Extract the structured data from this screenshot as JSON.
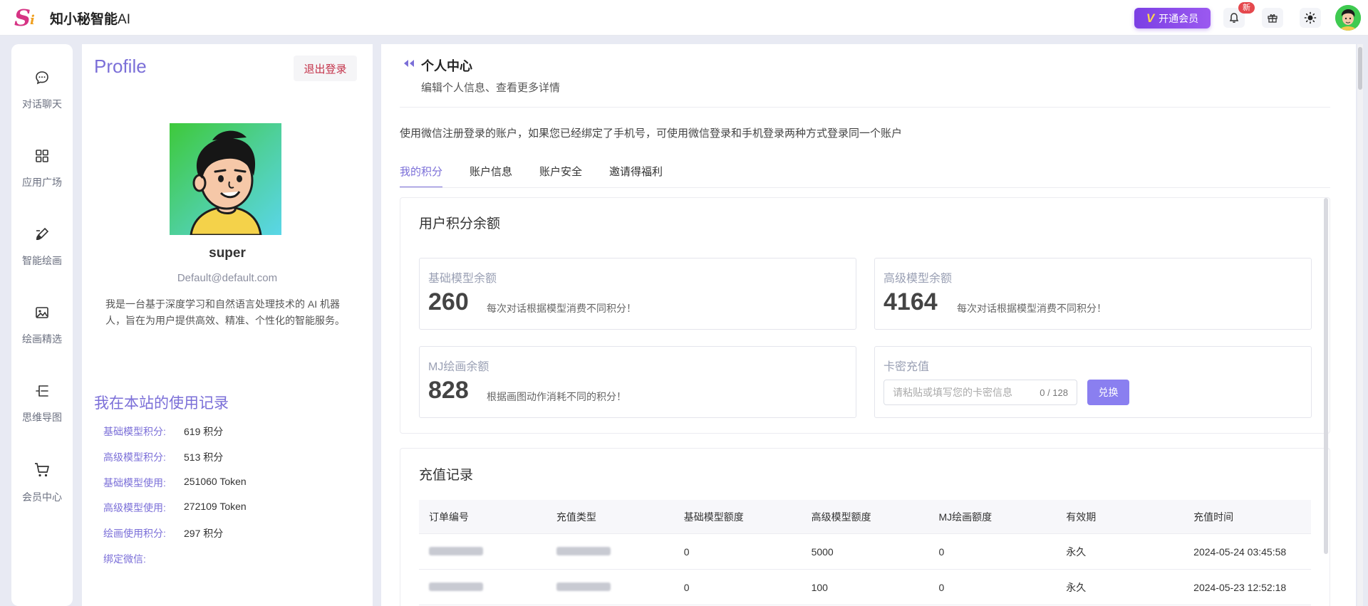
{
  "app": {
    "logo_text": "S",
    "logo_sub": "i",
    "brand_name": "知小秘智能",
    "brand_ai": "AI"
  },
  "topbar": {
    "vip_label": "开通会员",
    "vip_mark": "V",
    "notify_badge": "新",
    "accent_color": "#7b3fe4"
  },
  "rail": {
    "items": [
      {
        "label": "对话聊天",
        "icon": "chat-bubble-icon"
      },
      {
        "label": "应用广场",
        "icon": "grid-apps-icon"
      },
      {
        "label": "智能绘画",
        "icon": "paint-brush-icon"
      },
      {
        "label": "绘画精选",
        "icon": "image-gallery-icon"
      },
      {
        "label": "思维导图",
        "icon": "mind-map-icon"
      },
      {
        "label": "会员中心",
        "icon": "shopping-cart-icon"
      }
    ]
  },
  "profile": {
    "title": "Profile",
    "logout": "退出登录",
    "username": "super",
    "email": "Default@default.com",
    "bio": "我是一台基于深度学习和自然语言处理技术的 AI 机器人，旨在为用户提供高效、精准、个性化的智能服务。",
    "usage_title": "我在本站的使用记录",
    "usage": [
      {
        "key": "基础模型积分:",
        "value": "619 积分"
      },
      {
        "key": "高级模型积分:",
        "value": "513 积分"
      },
      {
        "key": "基础模型使用:",
        "value": "251060 Token"
      },
      {
        "key": "高级模型使用:",
        "value": "272109 Token"
      },
      {
        "key": "绘画使用积分:",
        "value": "297 积分"
      },
      {
        "key": "绑定微信:",
        "value": ""
      }
    ]
  },
  "main": {
    "title": "个人中心",
    "subtitle": "编辑个人信息、查看更多详情",
    "notice": "使用微信注册登录的账户，如果您已经绑定了手机号，可使用微信登录和手机登录两种方式登录同一个账户",
    "tabs": [
      "我的积分",
      "账户信息",
      "账户安全",
      "邀请得福利"
    ],
    "active_tab": 0,
    "balance": {
      "title": "用户积分余额",
      "stats": [
        {
          "label": "基础模型余额",
          "value": "260",
          "desc": "每次对话根据模型消费不同积分！"
        },
        {
          "label": "高级模型余额",
          "value": "4164",
          "desc": "每次对话根据模型消费不同积分！"
        },
        {
          "label": "MJ绘画余额",
          "value": "828",
          "desc": "根据画图动作消耗不同的积分！"
        }
      ],
      "redeem": {
        "label": "卡密充值",
        "placeholder": "请粘贴或填写您的卡密信息",
        "counter": "0 / 128",
        "button": "兑换"
      }
    },
    "recharge": {
      "title": "充值记录",
      "columns": [
        "订单编号",
        "充值类型",
        "基础模型额度",
        "高级模型额度",
        "MJ绘画额度",
        "有效期",
        "充值时间"
      ],
      "rows": [
        {
          "order": "",
          "type": "",
          "base": "0",
          "adv": "5000",
          "mj": "0",
          "validity": "永久",
          "time": "2024-05-24 03:45:58"
        },
        {
          "order": "",
          "type": "",
          "base": "0",
          "adv": "100",
          "mj": "0",
          "validity": "永久",
          "time": "2024-05-23 12:52:18"
        }
      ]
    }
  }
}
